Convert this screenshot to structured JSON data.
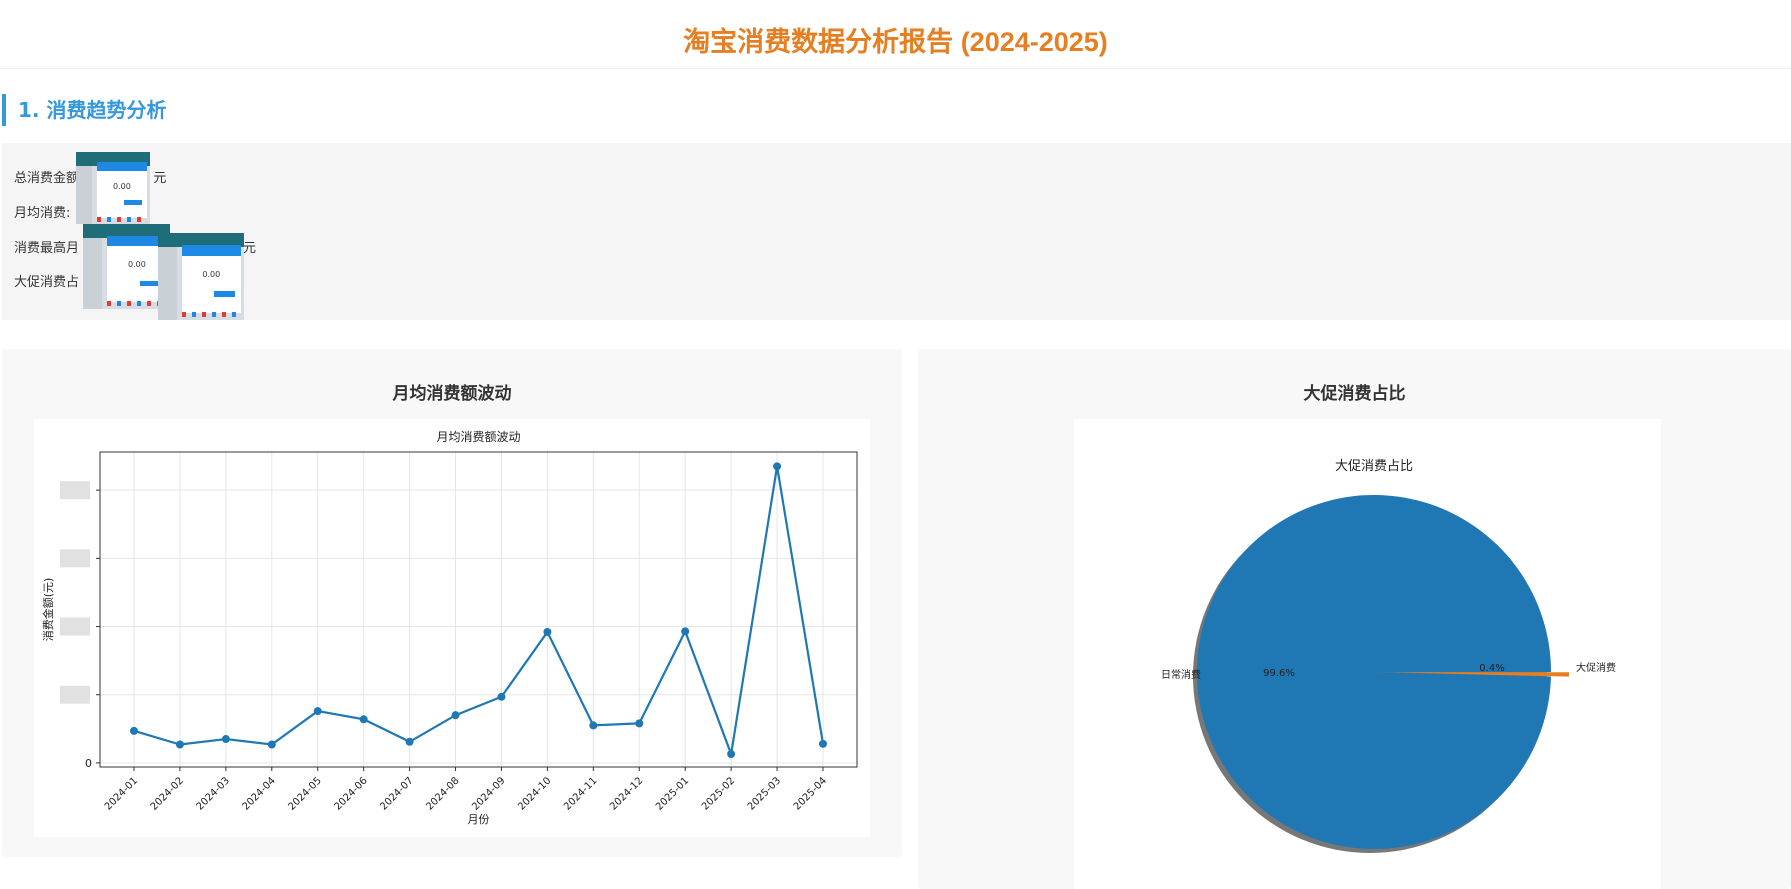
{
  "page_title": "淘宝消费数据分析报告 (2024-2025)",
  "section": {
    "heading": "1. 消费趋势分析"
  },
  "stats": [
    {
      "label": "总消费金额:",
      "value": "元"
    },
    {
      "label": "月均消费:",
      "value": ""
    },
    {
      "label": "消费最高月",
      "value": "元"
    },
    {
      "label": "大促消费占",
      "value": ""
    }
  ],
  "thumbnails": [
    {
      "amount": "0.00"
    },
    {
      "amount": "0.00"
    },
    {
      "amount": "0.00"
    }
  ],
  "cards": {
    "left_title": "月均消费额波动",
    "right_title": "大促消费占比"
  },
  "chart_data": [
    {
      "type": "line",
      "title": "月均消费额波动",
      "xlabel": "月份",
      "ylabel": "消费金额(元)",
      "categories": [
        "2024-01",
        "2024-02",
        "2024-03",
        "2024-04",
        "2024-05",
        "2024-06",
        "2024-07",
        "2024-08",
        "2024-09",
        "2024-10",
        "2024-11",
        "2024-12",
        "2025-01",
        "2025-02",
        "2025-03",
        "2025-04"
      ],
      "values": [
        470,
        270,
        350,
        270,
        760,
        640,
        310,
        700,
        970,
        1920,
        550,
        580,
        1930,
        130,
        4350,
        280
      ],
      "ylim": [
        -60,
        4560
      ],
      "yticks_visible": [
        "0"
      ],
      "grid": true,
      "color": "#1f77b4"
    },
    {
      "type": "pie",
      "title": "大促消费占比",
      "slices": [
        {
          "label": "日常消费",
          "value": 99.6,
          "pct_label": "99.6%",
          "color": "#1f77b4"
        },
        {
          "label": "大促消费",
          "value": 0.4,
          "pct_label": "0.4%",
          "color": "#e67e22"
        }
      ],
      "shadow": true
    }
  ]
}
